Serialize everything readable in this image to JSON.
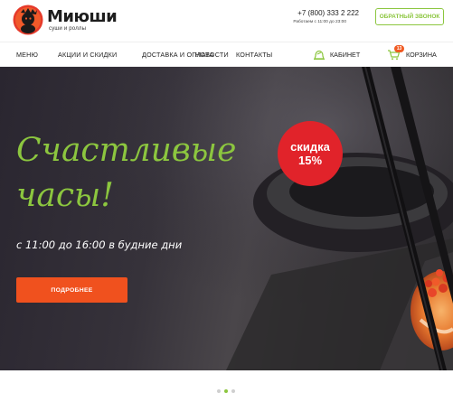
{
  "header": {
    "brand": "Миюши",
    "tagline": "суши и роллы",
    "phone": "+7 (800) 333 2 222",
    "hours": "Работаем с 11:00 до 23:00",
    "callback_label": "ОБРАТНЫЙ ЗВОНОК"
  },
  "nav": {
    "items": [
      {
        "label": "МЕНЮ"
      },
      {
        "label": "АКЦИИ И СКИДКИ"
      },
      {
        "label": "ДОСТАВКА И ОПЛАТА"
      },
      {
        "label": "НОВОСТИ"
      },
      {
        "label": "КОНТАКТЫ"
      }
    ],
    "cabinet_label": "КАБИНЕТ",
    "cart_label": "КОРЗИНА",
    "cart_count": "13",
    "cabinet_icon": "hat-icon",
    "cart_icon": "cart-icon"
  },
  "hero": {
    "title_line1": "Счастливые",
    "title_line2": "часы!",
    "subtitle": "с 11:00 до 16:00 в будние дни",
    "button_label": "ПОДРОБНЕЕ",
    "discount_line1": "скидка",
    "discount_line2": "15%"
  },
  "slider": {
    "count": 3,
    "active": 2
  },
  "colors": {
    "accent_green": "#8cc63f",
    "accent_orange": "#f0511e",
    "badge_red": "#e1232a"
  }
}
